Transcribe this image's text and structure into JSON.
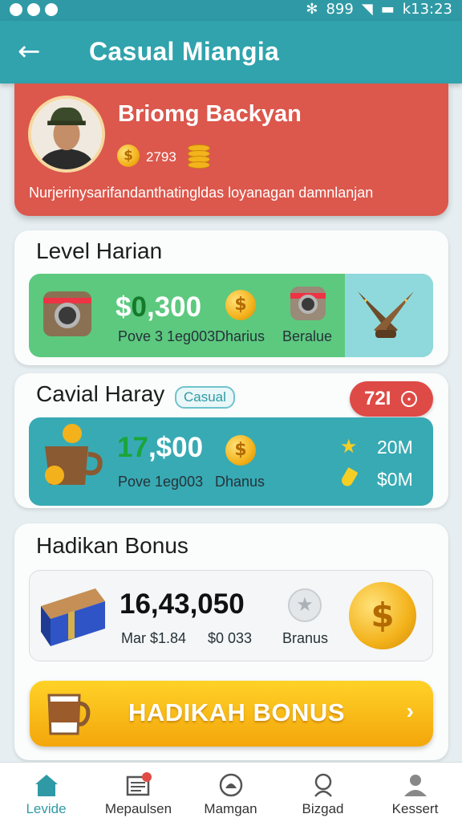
{
  "status_bar": {
    "battery": "899",
    "time": "k13:23"
  },
  "app_bar": {
    "title": "Casual Miangia"
  },
  "profile": {
    "name": "Briomg Backyan",
    "coins": "2793",
    "description": "Nurjerinysarifandanthatingldas loyanagan damnlanjan"
  },
  "level_card": {
    "title": "Level Harian",
    "amount_prefix": "$",
    "amount_highlight": "0",
    "amount_rest": ",300",
    "sub_left": "Pove 3 1eg003",
    "sub_mid": "Dharius",
    "sub_right": "Beralue"
  },
  "casual_card": {
    "title": "Cavial Haray",
    "badge": "Casual",
    "counter": "72I",
    "amount_highlight": "17",
    "amount_rest": ",$00",
    "sub_left": "Pove  1eg003",
    "sub_mid": "Dhanus",
    "stat1": "20M",
    "stat2": "$0M"
  },
  "bonus_card": {
    "title": "Hadikan Bonus",
    "amount": "16,43,050",
    "sub_left": "Mar  $1.84",
    "sub_mid": "$0 033",
    "sub_right": "Branus"
  },
  "cta": {
    "label": "HADIKAH BONUS",
    "chevron": "›"
  },
  "nav": [
    {
      "label": "Levide",
      "icon": "home-icon"
    },
    {
      "label": "Mepaulsen",
      "icon": "list-icon"
    },
    {
      "label": "Mamgan",
      "icon": "gauge-icon"
    },
    {
      "label": "Bizgad",
      "icon": "search-icon"
    },
    {
      "label": "Kessert",
      "icon": "user-icon"
    }
  ],
  "colors": {
    "accent": "#30a3ad",
    "profile_red": "#dc574c",
    "green_box": "#5cc97f",
    "teal_box": "#38aab4",
    "cta_yellow": "#f8b917"
  }
}
